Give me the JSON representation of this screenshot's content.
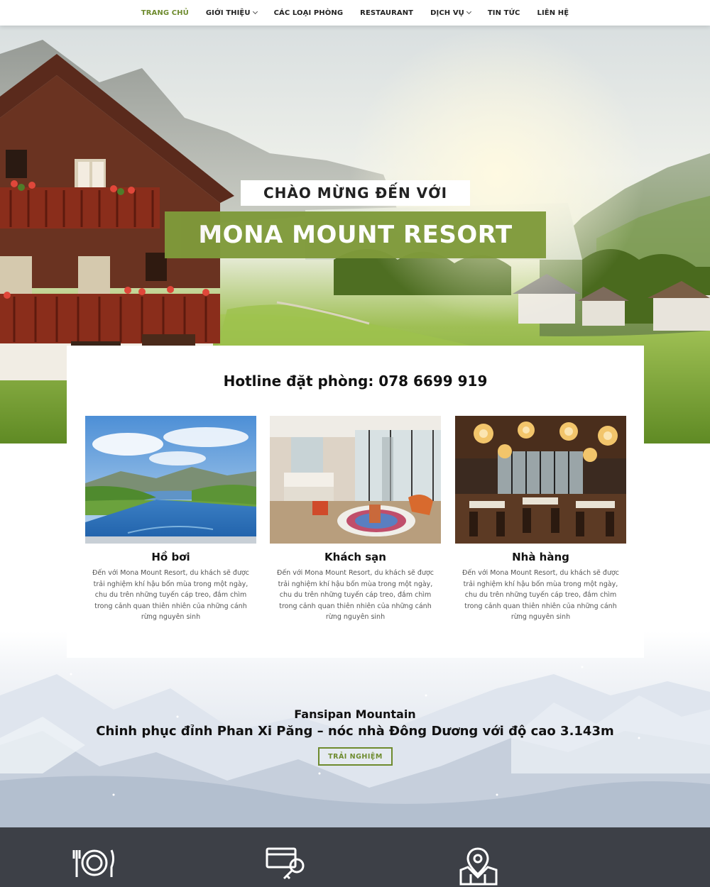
{
  "nav": {
    "items": [
      {
        "label": "TRANG CHỦ",
        "active": true,
        "dropdown": false
      },
      {
        "label": "GIỚI THIỆU",
        "active": false,
        "dropdown": true
      },
      {
        "label": "CÁC LOẠI PHÒNG",
        "active": false,
        "dropdown": false
      },
      {
        "label": "RESTAURANT",
        "active": false,
        "dropdown": false
      },
      {
        "label": "DỊCH VỤ",
        "active": false,
        "dropdown": true
      },
      {
        "label": "TIN TỨC",
        "active": false,
        "dropdown": false
      },
      {
        "label": "LIÊN HỆ",
        "active": false,
        "dropdown": false
      }
    ]
  },
  "hero": {
    "welcome": "CHÀO MỪNG ĐẾN VỚI",
    "name": "MONA MOUNT RESORT"
  },
  "hotline": "Hotline đặt phòng: 078 6699 919",
  "features": [
    {
      "title": "Hồ bơi",
      "description": "Đến với Mona Mount Resort, du khách sẽ được trải nghiệm khí hậu bốn mùa trong một ngày, chu du trên những tuyến cáp treo, đắm chìm trong cảnh quan thiên nhiên của những cánh rừng nguyên sinh",
      "image": "infinity-pool-lake-view"
    },
    {
      "title": "Khách sạn",
      "description": "Đến với Mona Mount Resort, du khách sẽ được trải nghiệm khí hậu bốn mùa trong một ngày, chu du trên những tuyến cáp treo, đắm chìm trong cảnh quan thiên nhiên của những cánh rừng nguyên sinh",
      "image": "hotel-room-interior"
    },
    {
      "title": "Nhà hàng",
      "description": "Đến với Mona Mount Resort, du khách sẽ được trải nghiệm khí hậu bốn mùa trong một ngày, chu du trên những tuyến cáp treo, đắm chìm trong cảnh quan thiên nhiên của những cánh rừng nguyên sinh",
      "image": "restaurant-chandeliers"
    }
  ],
  "mountain": {
    "title": "Fansipan Mountain",
    "subtitle": "Chinh phục đỉnh Phan Xi Păng – nóc nhà Đông Dương với độ cao 3.143m",
    "button": "TRẢI NGHIỆM"
  },
  "icons": [
    "dining-plate-icon",
    "key-card-icon",
    "map-location-icon"
  ],
  "colors": {
    "accent": "#7f9a3a",
    "accent_text": "#6e8b2e",
    "footer": "#3d4047"
  }
}
